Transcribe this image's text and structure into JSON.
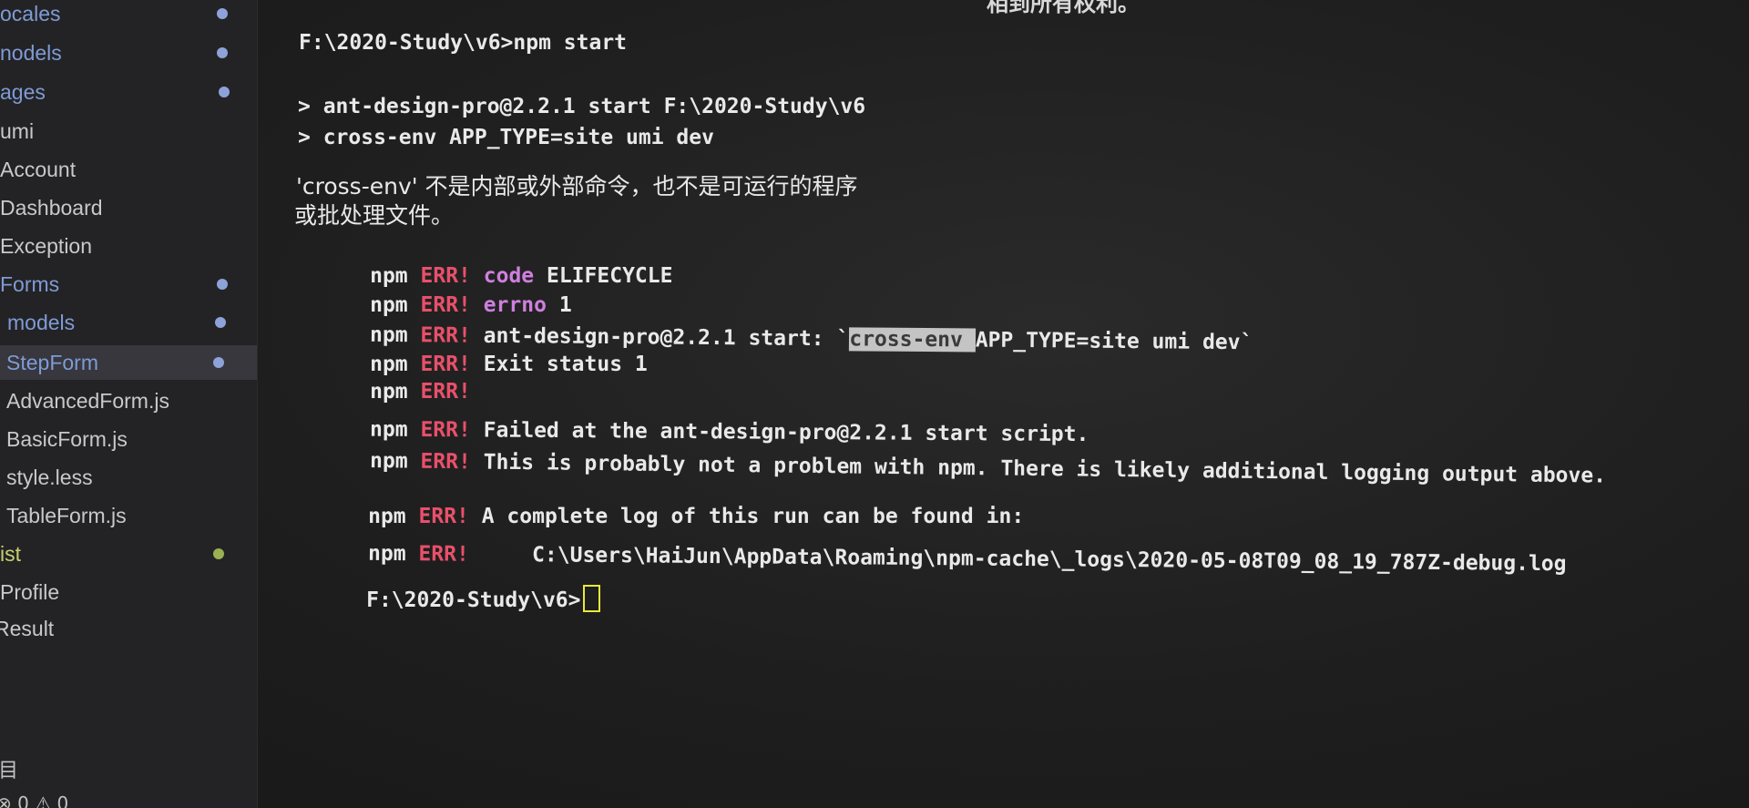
{
  "explorer": {
    "items": [
      {
        "label": "ocales",
        "modified": true
      },
      {
        "label": "nodels",
        "modified": true
      },
      {
        "label": "ages",
        "modified": true
      },
      {
        "label": "umi",
        "modified": false
      },
      {
        "label": "Account",
        "modified": false
      },
      {
        "label": "Dashboard",
        "modified": false
      },
      {
        "label": "Exception",
        "modified": false
      },
      {
        "label": "Forms",
        "modified": true
      },
      {
        "label": "models",
        "modified": true
      },
      {
        "label": "StepForm",
        "modified": true,
        "selected": true
      },
      {
        "label": "AdvancedForm.js",
        "modified": false
      },
      {
        "label": "BasicForm.js",
        "modified": false
      },
      {
        "label": "style.less",
        "modified": false
      },
      {
        "label": "TableForm.js",
        "modified": false
      },
      {
        "label": "ist",
        "modified": true,
        "dot_color": "#9ab053"
      },
      {
        "label": "Profile",
        "modified": false
      },
      {
        "label": "Result",
        "modified": false
      }
    ],
    "bottom_glyph": "目",
    "status_bar": "⊗ 0 ⚠ 0"
  },
  "terminal": {
    "top_partial_text": "相到所有权利。",
    "prompt_cmd": "F:\\2020-Study\\v6>npm start",
    "script_line_1": "> ant-design-pro@2.2.1 start F:\\2020-Study\\v6",
    "script_line_2": "> cross-env APP_TYPE=site umi dev",
    "cn_line_1": "'cross-env' 不是内部或外部命令，也不是可运行的程序",
    "cn_line_2": "或批处理文件。",
    "npm_label": "npm",
    "err_label": "ERR!",
    "err_lines": {
      "code_kw": "code",
      "code_val": " ELIFECYCLE",
      "errno_kw": "errno",
      "errno_val": " 1",
      "start_prefix": " ant-design-pro@2.2.1 start: `",
      "start_selected": "cross-env ",
      "start_suffix": "APP_TYPE=site umi dev`",
      "exit_status": " Exit status 1",
      "empty": "",
      "failed_at": " Failed at the ant-design-pro@2.2.1 start script.",
      "probably": " This is probably not a problem with npm. There is likely additional logging output above.",
      "complete_log": " A complete log of this run can be found in:",
      "log_path": "     C:\\Users\\HaiJun\\AppData\\Roaming\\npm-cache\\_logs\\2020-05-08T09_08_19_787Z-debug.log"
    },
    "final_prompt": "F:\\2020-Study\\v6>"
  },
  "colors": {
    "err": "#e8506a",
    "keyword": "#cf7fde",
    "cursor": "#e9e93a",
    "modified_dot": "#8da2d8"
  }
}
